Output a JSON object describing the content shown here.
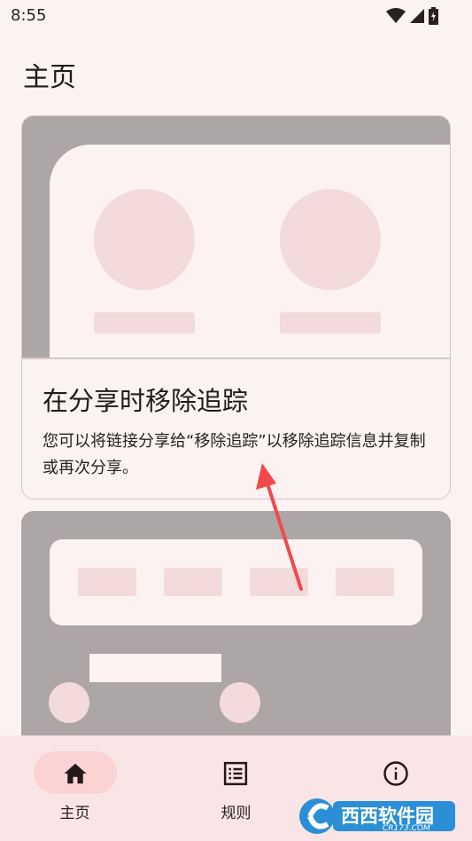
{
  "status_bar": {
    "time": "8:55",
    "icons": [
      "wifi-icon",
      "signal-icon",
      "battery-charging-icon"
    ]
  },
  "page": {
    "title": "主页"
  },
  "cards": [
    {
      "title": "在分享时移除追踪",
      "description": "您可以将链接分享给“移除追踪”以移除追踪信息并复制或再次分享。"
    }
  ],
  "bottom_nav": {
    "items": [
      {
        "label": "主页",
        "icon": "home-icon",
        "active": true
      },
      {
        "label": "规则",
        "icon": "list-icon",
        "active": false
      },
      {
        "label": "",
        "icon": "info-icon",
        "active": false
      }
    ]
  },
  "watermark": {
    "text": "西西软件园",
    "sub": "CR173.COM"
  },
  "colors": {
    "background": "#fdf2f2",
    "illustration_gray": "#aca6a6",
    "illustration_pink": "#f3dbdb",
    "nav_background": "#f9e5e5",
    "nav_active_pill": "#fbd3d3",
    "annotation_arrow": "#f04a4a"
  }
}
